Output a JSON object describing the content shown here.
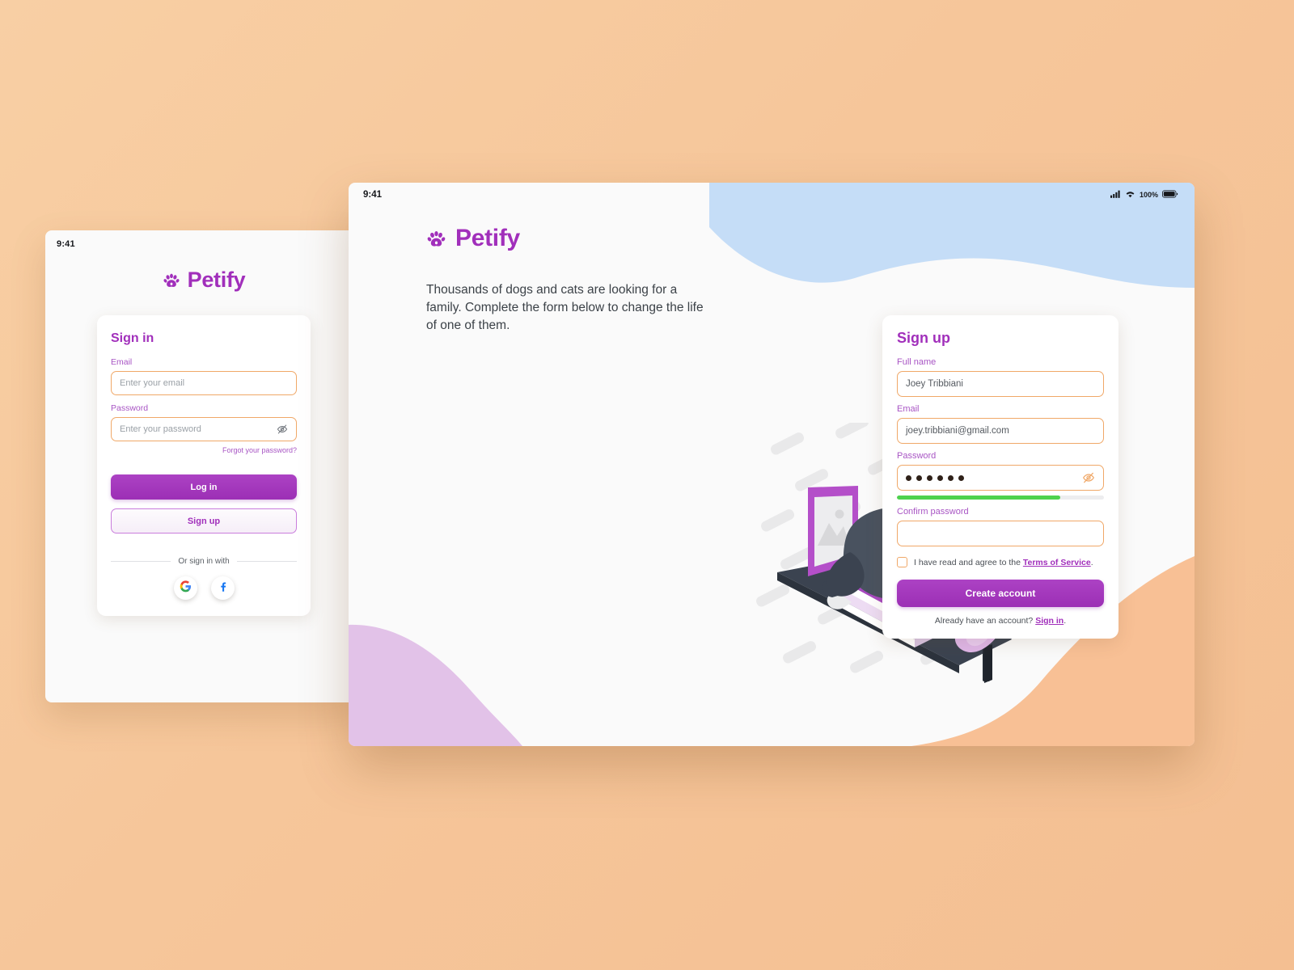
{
  "brand": {
    "name": "Petify",
    "icon": "paw-icon",
    "color": "#a12fbb"
  },
  "phone": {
    "status": {
      "clock": "9:41"
    },
    "signin": {
      "title": "Sign in",
      "email_label": "Email",
      "email_placeholder": "Enter your email",
      "password_label": "Password",
      "password_placeholder": "Enter your password",
      "password_toggle_icon": "eye-off-icon",
      "forgot_label": "Forgot your password?",
      "login_button": "Log in",
      "signup_button": "Sign up",
      "divider_label": "Or sign in with",
      "social": [
        {
          "name": "google",
          "label": "G"
        },
        {
          "name": "facebook",
          "label": "f"
        }
      ]
    }
  },
  "tablet": {
    "status": {
      "clock": "9:41",
      "signal_icon": "cellular-signal-icon",
      "wifi_icon": "wifi-icon",
      "battery_percent": "100%",
      "battery_icon": "battery-full-icon"
    },
    "tagline": "Thousands of dogs and cats are looking for a family. Complete the form below to change the life of one of them.",
    "illustration": {
      "name": "cat-on-books-shelf-illustration",
      "elements": [
        "cat",
        "books",
        "picture-frame",
        "flower-vase",
        "wall-shelf",
        "brick-wall-pattern"
      ]
    },
    "signup": {
      "title": "Sign up",
      "fullname_label": "Full name",
      "fullname_value": "Joey Tribbiani",
      "email_label": "Email",
      "email_value": "joey.tribbiani@gmail.com",
      "password_label": "Password",
      "password_value": "••••••",
      "password_dots": 6,
      "password_toggle_icon": "eye-off-icon",
      "password_strength_percent": 79,
      "password_strength_color": "#4ed24e",
      "confirm_label": "Confirm password",
      "confirm_value": "",
      "terms_prefix": "I have read and agree to the ",
      "terms_link": "Terms of Service",
      "terms_suffix": ".",
      "terms_checked": false,
      "submit_button": "Create account",
      "already_prefix": "Already have an account? ",
      "already_link": "Sign in",
      "already_suffix": "."
    }
  },
  "decor": {
    "blob_blue": "#c5ddf7",
    "blob_purple": "#e2c2e8",
    "blob_orange": "#f8c095",
    "page_background": "#f6c69a"
  }
}
